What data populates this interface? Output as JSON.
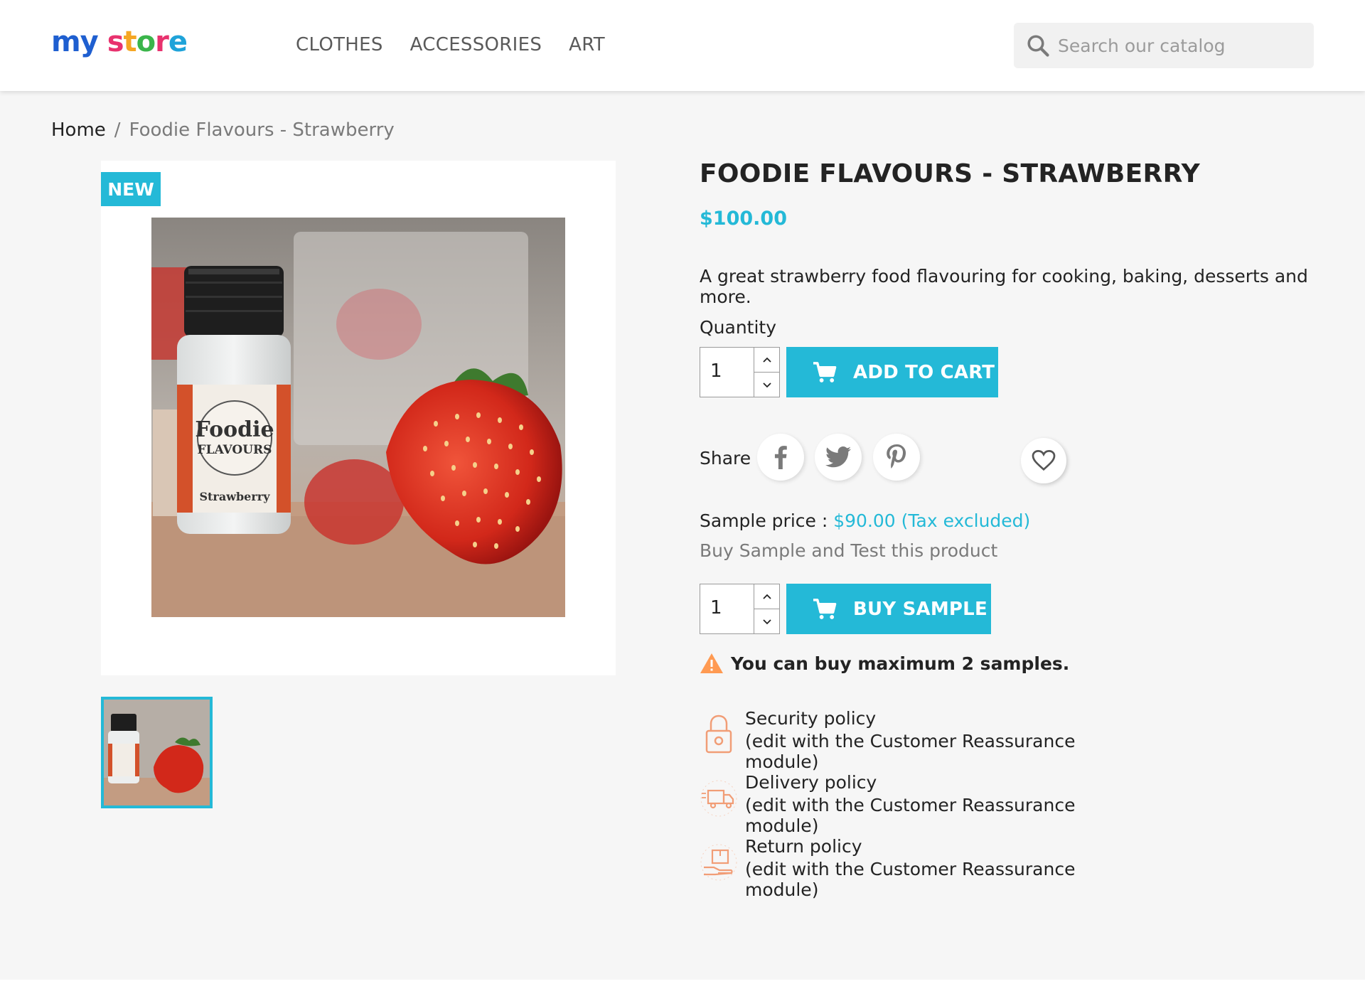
{
  "header": {
    "logo_text": "my store",
    "nav": [
      "CLOTHES",
      "ACCESSORIES",
      "ART"
    ],
    "search_placeholder": "Search our catalog"
  },
  "breadcrumb": {
    "home": "Home",
    "separator": "/",
    "current": "Foodie Flavours - Strawberry"
  },
  "product": {
    "badge": "NEW",
    "title": "FOODIE FLAVOURS - STRAWBERRY",
    "price": "$100.00",
    "description": "A great strawberry food flavouring for cooking, baking, desserts and more.",
    "quantity_label": "Quantity",
    "quantity_value": "1",
    "add_to_cart": "ADD TO CART",
    "share_label": "Share",
    "social": [
      "facebook-icon",
      "twitter-icon",
      "pinterest-icon"
    ],
    "label_text": "Strawberry",
    "brand_text": "Foodie",
    "brand_sub": "FLAVOURS"
  },
  "sample": {
    "price_label": "Sample price : ",
    "price_value": "$90.00 (Tax excluded)",
    "subtitle": "Buy Sample and Test this product",
    "quantity_value": "1",
    "button": "BUY SAMPLE",
    "warning": "You can buy maximum 2 samples."
  },
  "reassurance": [
    {
      "title": "Security policy",
      "note": "(edit with the Customer Reassurance module)",
      "icon": "lock-icon"
    },
    {
      "title": "Delivery policy",
      "note": "(edit with the Customer Reassurance module)",
      "icon": "truck-icon"
    },
    {
      "title": "Return policy",
      "note": "(edit with the Customer Reassurance module)",
      "icon": "return-box-icon"
    }
  ],
  "colors": {
    "accent": "#24b9d7",
    "warning": "#ff9a52",
    "reassurance_icon": "#f19d76"
  }
}
